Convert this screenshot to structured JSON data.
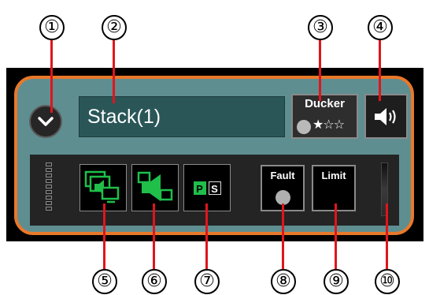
{
  "callouts": [
    "①",
    "②",
    "③",
    "④",
    "⑤",
    "⑥",
    "⑦",
    "⑧",
    "⑨",
    "⑩"
  ],
  "stack": {
    "name": "Stack(1)",
    "ducker": {
      "label": "Ducker",
      "priority": 1,
      "priority_max": 3,
      "priority_display": "★☆☆"
    },
    "fault_label": "Fault",
    "limit_label": "Limit",
    "ps": {
      "p": "P",
      "s": "S"
    }
  },
  "icons": [
    "chevron-down-icon",
    "speaker-icon",
    "multi-monitor-icon",
    "monitor-speaker-icon",
    "drag-handle-icon"
  ],
  "colors": {
    "accent_orange": "#e8782a",
    "panel_teal": "#5f8e91",
    "icon_green": "#1fbf4a",
    "callout_line": "#e0151b"
  }
}
